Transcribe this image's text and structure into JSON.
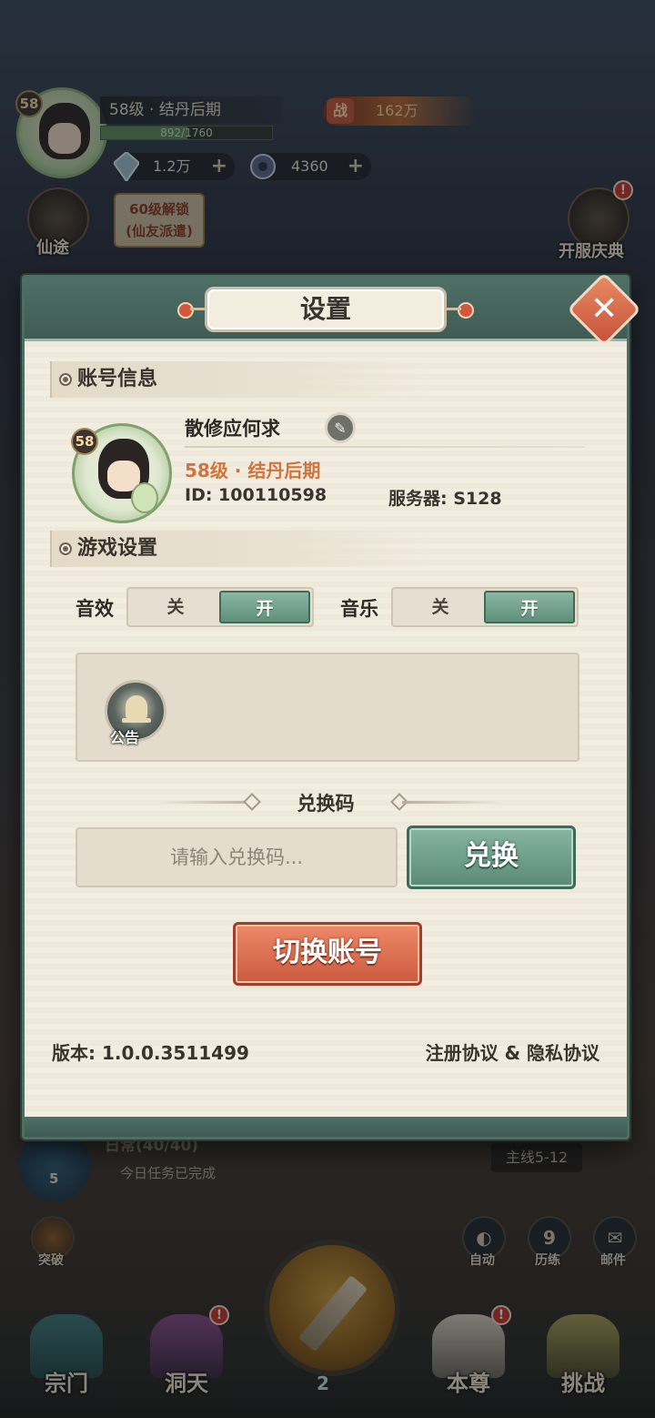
{
  "hud": {
    "player_level_badge": "58",
    "player_title": "58级 · 结丹后期",
    "exp_text": "892/1760",
    "exp_fraction": 0.507,
    "power_icon": "战",
    "power_value": "162万",
    "resource1_value": "1.2万",
    "resource2_value": "4360",
    "journey_label": "仙途",
    "lock_text_line1": "60级解锁",
    "lock_text_line2": "(仙友派遣)",
    "celebration_label": "开服庆典",
    "daily_task_title": "日常(40/40)",
    "daily_task_sub": "今日任务已完成",
    "daily_task_count": "5",
    "mainline_label": "主线5-12",
    "breakthrough_label": "突破",
    "auto_label": "自动",
    "trial_count": "9",
    "trial_label": "历练",
    "mail_label": "邮件",
    "center_count": "2",
    "nav": [
      "宗门",
      "洞天",
      "本尊",
      "挑战"
    ],
    "badge_mark": "!"
  },
  "dialog": {
    "title": "设置",
    "close_symbol": "✕",
    "account_section": "账号信息",
    "avatar_level": "58",
    "nickname": "散修应何求",
    "level_title": "58级 · 结丹后期",
    "player_id": "ID: 100110598",
    "server": "服务器: S128",
    "game_section": "游戏设置",
    "sound_label": "音效",
    "music_label": "音乐",
    "off_label": "关",
    "on_label": "开",
    "notice_label": "公告",
    "redeem_title": "兑换码",
    "redeem_placeholder": "请输入兑换码...",
    "redeem_button": "兑换",
    "switch_account": "切换账号",
    "version": "版本: 1.0.0.3511499",
    "policy": "注册协议 & 隐私协议"
  },
  "colors": {
    "accent_green": "#5f8f7b",
    "accent_orange": "#cc5a3e",
    "level_text": "#d0743d"
  }
}
